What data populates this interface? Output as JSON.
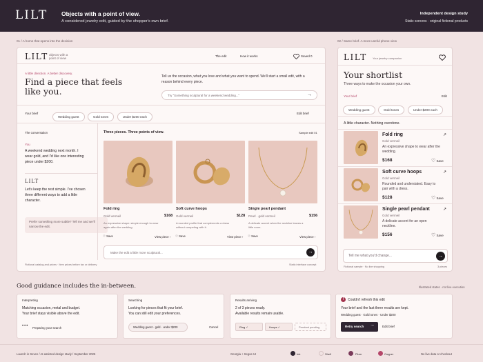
{
  "header": {
    "logo": "LILT",
    "title": "Objects with a point of view.",
    "subtitle": "A considered jewelry edit, guided by the shopper's own brief.",
    "right_top": "Independent design study",
    "right_bottom": "Static screens · original fictional products"
  },
  "captions": {
    "desktop": "01 / A home that opens into the decision",
    "phone": "02 / Same brief. A more useful phone view",
    "guidance_title": "Good guidance includes the in-between.",
    "guidance_note": "Illustrated states · not live execution"
  },
  "desktop": {
    "logo": "LILT",
    "tagline_1": "objects with a",
    "tagline_2": "point of view",
    "nav": [
      "The edit",
      "How it works"
    ],
    "saved": "Saved 0",
    "kicker": "A little direction. A better discovery.",
    "headline": "Find a piece that feels like you.",
    "intro": "Tell us the occasion, what you love and what you want to spend. We'll start a small edit, with a reason behind every piece.",
    "prompt_placeholder": "Try \"Something sculptural for a weekend wedding...\"",
    "brief_label": "Your brief",
    "brief_pills": [
      "Wedding guest",
      "Gold tones",
      "Under $200 each"
    ],
    "edit_brief": "Edit brief",
    "conversation_label": "The conversation",
    "you_label": "You",
    "you_msg": "A weekend wedding next month. I wear gold, and I'd like one interesting piece under $200.",
    "lilt_label": "LILT",
    "lilt_msg": "Let's keep the rest simple. I've chosen three different ways to add a little character.",
    "subtle_note": "Prefer something more subtle? Tell me and we'll narrow the edit.",
    "edit_title": "Three pieces. Three points of view.",
    "sample_label": "Sample edit 01",
    "products": [
      {
        "name": "Fold ring",
        "price": "$168",
        "material": "Gold vermeil",
        "desc": "An expressive shape: simple enough to wear again after the wedding.",
        "view": "View piece",
        "save": "Save"
      },
      {
        "name": "Soft curve hoops",
        "price": "$128",
        "material": "Gold vermeil",
        "desc": "A rounded profile that complements a dress without competing with it.",
        "view": "View piece",
        "save": "Save"
      },
      {
        "name": "Single pearl pendant",
        "price": "$156",
        "material": "Pearl · gold vermeil",
        "desc": "A delicate accent when the neckline leaves a little room.",
        "view": "View piece",
        "save": "Save"
      }
    ],
    "refine_placeholder": "Make the edit a little more sculptural...",
    "footer_left": "Fictional catalog and prices · Item prices before tax or delivery",
    "footer_right": "Static interface concept"
  },
  "phone": {
    "logo": "LILT",
    "sublogo": "Your jewelry companion",
    "title": "Your shortlist",
    "subtitle": "Three ways to make the occasion your own.",
    "brief_label": "Your brief",
    "edit": "Edit",
    "pills": [
      "Wedding guest",
      "Gold tones",
      "Under $200 each"
    ],
    "note": "A little character. Nothing overdone.",
    "products": [
      {
        "name": "Fold ring",
        "material": "Gold vermeil",
        "desc": "An expressive shape to wear after the wedding.",
        "price": "$168",
        "save": "Save"
      },
      {
        "name": "Soft curve hoops",
        "material": "Gold vermeil",
        "desc": "Rounded and understated. Easy to pair with a dress.",
        "price": "$128",
        "save": "Save"
      },
      {
        "name": "Single pearl pendant",
        "material": "Gold vermeil",
        "desc": "A delicate accent for an open neckline.",
        "price": "$156",
        "save": "Save"
      }
    ],
    "input_placeholder": "Tell me what you'd change...",
    "footer_left": "Fictional sample · No live shopping",
    "footer_right": "3 pieces"
  },
  "states": [
    {
      "title": "Interpreting",
      "l1": "Matching occasion, metal and budget.",
      "l2": "Your brief stays visible above the edit.",
      "status": "Preparing your search"
    },
    {
      "title": "Searching",
      "l1": "Looking for pieces that fit your brief.",
      "l2": "You can still edit your preferences.",
      "chip": "Wedding guest · gold · under $200",
      "cancel": "Cancel"
    },
    {
      "title": "Results arriving",
      "l1": "2 of 3 pieces ready.",
      "l2": "Available results remain usable.",
      "chips": [
        "Ring ✓",
        "Hoops ✓",
        "Pendant pending"
      ]
    },
    {
      "title": "Couldn't refresh this edit",
      "l1": "Your brief and the last three results are kept.",
      "l2": "Wedding guest · Gold tones · Under $200",
      "retry": "Retry search",
      "edit": "Edit brief"
    }
  ],
  "footer": {
    "left": "Launch in Seven / AI-assisted design study / September 2026",
    "fonts": "Georgia + Segoe UI",
    "swatches": [
      {
        "label": "Ink",
        "color": "#2f2532"
      },
      {
        "label": "Shell",
        "color": "#f1e3e3"
      },
      {
        "label": "Plum",
        "color": "#7a3a5a"
      },
      {
        "label": "Copper",
        "color": "#b5476a"
      }
    ],
    "right": "No live data or checkout"
  }
}
